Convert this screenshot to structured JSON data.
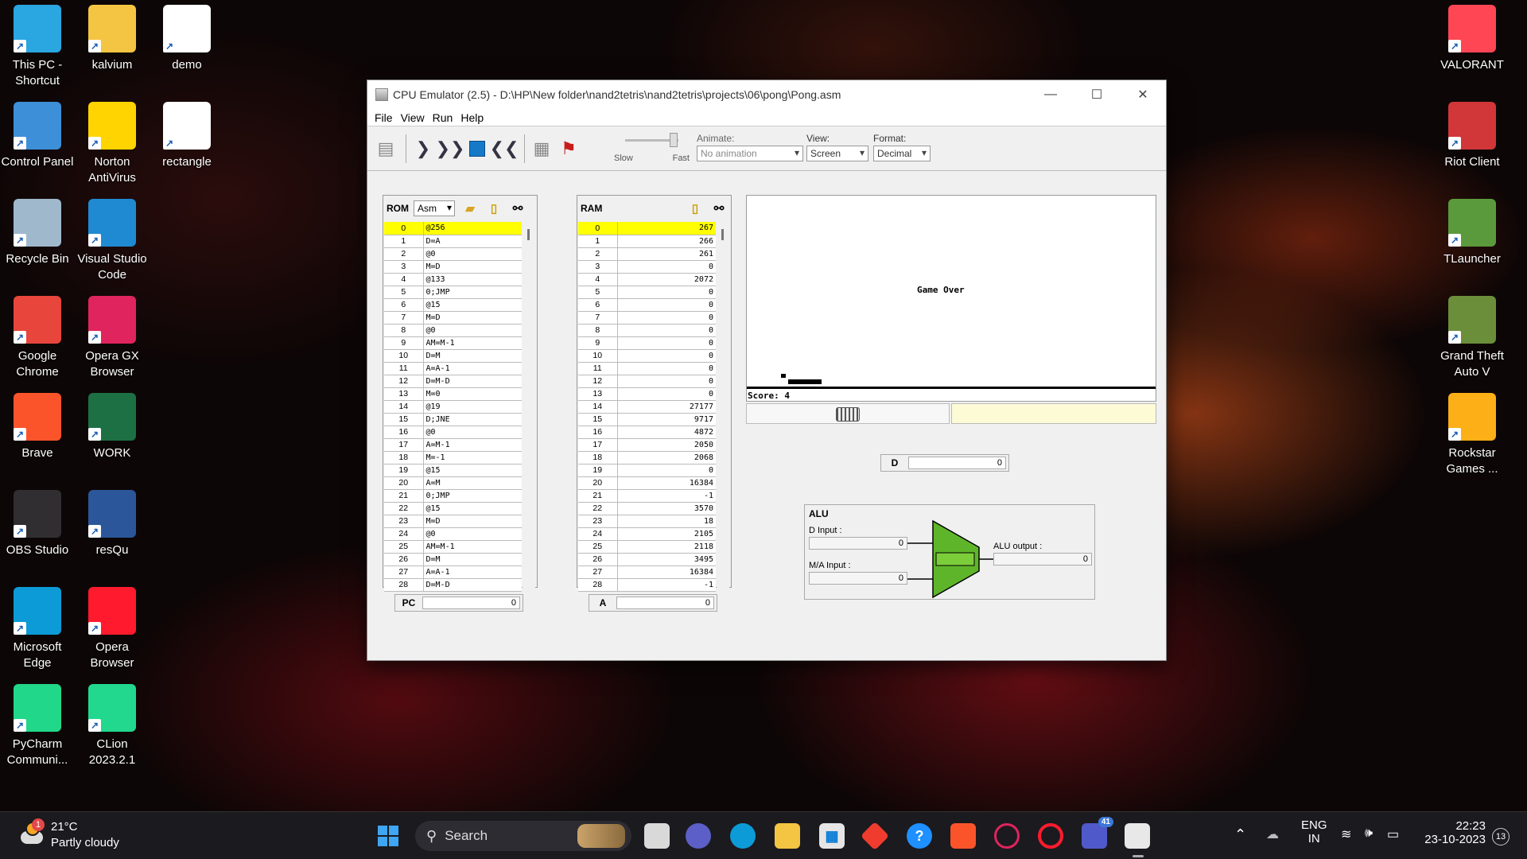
{
  "desktop_left": [
    {
      "label": "This PC - Shortcut",
      "icon": "monitor-icon",
      "color": "#2aa6e0"
    },
    {
      "label": "kalvium",
      "icon": "folder-icon",
      "color": "#f4c542"
    },
    {
      "label": "demo",
      "icon": "document-icon",
      "color": "#ffffff"
    },
    {
      "label": "Control Panel",
      "icon": "control-panel-icon",
      "color": "#3d8fd8"
    },
    {
      "label": "Norton AntiVirus",
      "icon": "norton-icon",
      "color": "#ffd400"
    },
    {
      "label": "rectangle",
      "icon": "document-icon",
      "color": "#ffffff"
    },
    {
      "label": "Recycle Bin",
      "icon": "recycle-bin-icon",
      "color": "#9fb8cc"
    },
    {
      "label": "Visual Studio Code",
      "icon": "vscode-icon",
      "color": "#1f8ad2"
    },
    {
      "label": "Google Chrome",
      "icon": "chrome-icon",
      "color": "#e8453c"
    },
    {
      "label": "Opera GX Browser",
      "icon": "opera-gx-icon",
      "color": "#e0245e"
    },
    {
      "label": "Brave",
      "icon": "brave-icon",
      "color": "#fb542b"
    },
    {
      "label": "WORK",
      "icon": "excel-icon",
      "color": "#1d7044"
    },
    {
      "label": "OBS Studio",
      "icon": "obs-icon",
      "color": "#302e31"
    },
    {
      "label": "resQu",
      "icon": "word-icon",
      "color": "#2b579a"
    },
    {
      "label": "Microsoft Edge",
      "icon": "edge-icon",
      "color": "#0c9bd6"
    },
    {
      "label": "Opera Browser",
      "icon": "opera-icon",
      "color": "#ff1b2d"
    },
    {
      "label": "PyCharm Communi...",
      "icon": "pycharm-icon",
      "color": "#21d789"
    },
    {
      "label": "CLion 2023.2.1",
      "icon": "clion-icon",
      "color": "#22d88f"
    }
  ],
  "desktop_right": [
    {
      "label": "VALORANT",
      "icon": "valorant-icon",
      "color": "#ff4655"
    },
    {
      "label": "Riot Client",
      "icon": "riot-client-icon",
      "color": "#d13639"
    },
    {
      "label": "TLauncher",
      "icon": "minecraft-icon",
      "color": "#5b9a3c"
    },
    {
      "label": "Grand Theft Auto V",
      "icon": "gta-icon",
      "color": "#6b8e3a"
    },
    {
      "label": "Rockstar Games ...",
      "icon": "rockstar-icon",
      "color": "#fcaf17"
    }
  ],
  "window": {
    "title": "CPU Emulator (2.5) - D:\\HP\\New folder\\nand2tetris\\nand2tetris\\projects\\06\\pong\\Pong.asm",
    "menu": [
      "File",
      "View",
      "Run",
      "Help"
    ],
    "slider": {
      "slow": "Slow",
      "fast": "Fast"
    },
    "animate": {
      "label": "Animate:",
      "value": "No animation"
    },
    "view": {
      "label": "View:",
      "value": "Screen"
    },
    "format": {
      "label": "Format:",
      "value": "Decimal"
    }
  },
  "rom": {
    "label": "ROM",
    "mode": "Asm",
    "rows": [
      [
        "0",
        "@256"
      ],
      [
        "1",
        "D=A"
      ],
      [
        "2",
        "@0"
      ],
      [
        "3",
        "M=D"
      ],
      [
        "4",
        "@133"
      ],
      [
        "5",
        "0;JMP"
      ],
      [
        "6",
        "@15"
      ],
      [
        "7",
        "M=D"
      ],
      [
        "8",
        "@0"
      ],
      [
        "9",
        "AM=M-1"
      ],
      [
        "10",
        "D=M"
      ],
      [
        "11",
        "A=A-1"
      ],
      [
        "12",
        "D=M-D"
      ],
      [
        "13",
        "M=0"
      ],
      [
        "14",
        "@19"
      ],
      [
        "15",
        "D;JNE"
      ],
      [
        "16",
        "@0"
      ],
      [
        "17",
        "A=M-1"
      ],
      [
        "18",
        "M=-1"
      ],
      [
        "19",
        "@15"
      ],
      [
        "20",
        "A=M"
      ],
      [
        "21",
        "0;JMP"
      ],
      [
        "22",
        "@15"
      ],
      [
        "23",
        "M=D"
      ],
      [
        "24",
        "@0"
      ],
      [
        "25",
        "AM=M-1"
      ],
      [
        "26",
        "D=M"
      ],
      [
        "27",
        "A=A-1"
      ],
      [
        "28",
        "D=M-D"
      ]
    ]
  },
  "ram": {
    "label": "RAM",
    "rows": [
      [
        "0",
        "267"
      ],
      [
        "1",
        "266"
      ],
      [
        "2",
        "261"
      ],
      [
        "3",
        "0"
      ],
      [
        "4",
        "2072"
      ],
      [
        "5",
        "0"
      ],
      [
        "6",
        "0"
      ],
      [
        "7",
        "0"
      ],
      [
        "8",
        "0"
      ],
      [
        "9",
        "0"
      ],
      [
        "10",
        "0"
      ],
      [
        "11",
        "0"
      ],
      [
        "12",
        "0"
      ],
      [
        "13",
        "0"
      ],
      [
        "14",
        "27177"
      ],
      [
        "15",
        "9717"
      ],
      [
        "16",
        "4872"
      ],
      [
        "17",
        "2050"
      ],
      [
        "18",
        "2068"
      ],
      [
        "19",
        "0"
      ],
      [
        "20",
        "16384"
      ],
      [
        "21",
        "-1"
      ],
      [
        "22",
        "3570"
      ],
      [
        "23",
        "18"
      ],
      [
        "24",
        "2105"
      ],
      [
        "25",
        "2118"
      ],
      [
        "26",
        "3495"
      ],
      [
        "27",
        "16384"
      ],
      [
        "28",
        "-1"
      ]
    ]
  },
  "registers": {
    "pc_label": "PC",
    "pc_value": "0",
    "a_label": "A",
    "a_value": "0",
    "d_label": "D",
    "d_value": "0"
  },
  "screen": {
    "game_over": "Game Over",
    "score": "Score: 4"
  },
  "alu": {
    "title": "ALU",
    "d_input_label": "D Input :",
    "d_input_value": "0",
    "ma_input_label": "M/A Input :",
    "ma_input_value": "0",
    "output_label": "ALU output :",
    "output_value": "0"
  },
  "taskbar": {
    "weather_temp": "21°C",
    "weather_desc": "Partly cloudy",
    "weather_badge": "1",
    "search": "Search",
    "teams_badge": "41",
    "lang_line1": "ENG",
    "lang_line2": "IN",
    "time": "22:23",
    "date": "23-10-2023",
    "notif_count": "13"
  }
}
